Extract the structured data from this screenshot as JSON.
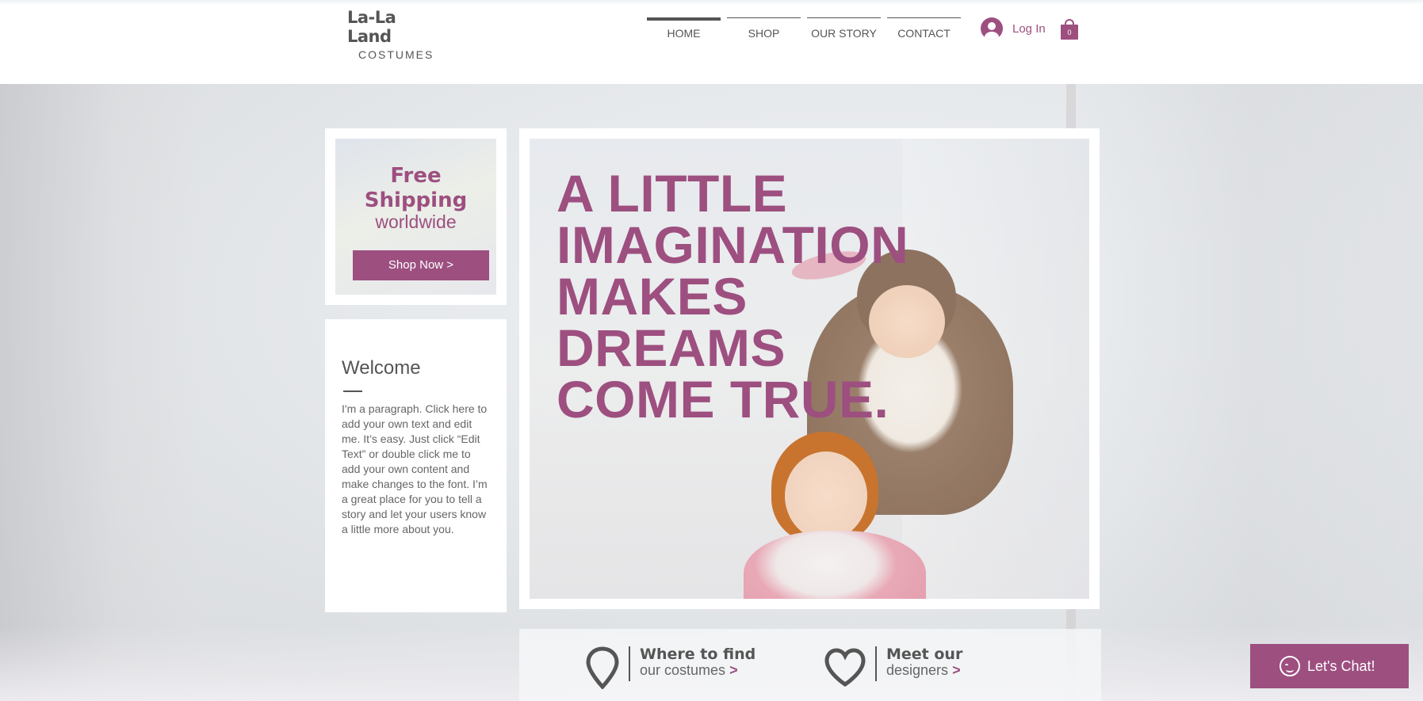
{
  "brand": {
    "name": "La-La Land",
    "tagline": "COSTUMES"
  },
  "nav": {
    "items": [
      {
        "label": "HOME",
        "active": true
      },
      {
        "label": "SHOP",
        "active": false
      },
      {
        "label": "OUR STORY",
        "active": false
      },
      {
        "label": "CONTACT",
        "active": false
      }
    ]
  },
  "account": {
    "login_label": "Log In",
    "cart_count": "0"
  },
  "promo": {
    "title_line1": "Free",
    "title_line2": "Shipping",
    "subtitle": "worldwide",
    "button_label": "Shop Now >"
  },
  "welcome": {
    "title": "Welcome",
    "paragraph": "I'm a paragraph. Click here to add your own text and edit me. It’s easy. Just click “Edit Text” or double click me to add your own content and make changes to the font. I’m a great place for you to tell a story and let your users know a little more about you."
  },
  "hero": {
    "lines": [
      "A LITTLE",
      "IMAGINATION",
      "MAKES",
      "DREAMS",
      "COME TRUE."
    ]
  },
  "info": {
    "find": {
      "line1": "Where to find",
      "line2": "our costumes",
      "arrow": ">",
      "icon": "map-pin-icon"
    },
    "designers": {
      "line1": "Meet our",
      "line2": "designers",
      "arrow": ">",
      "icon": "heart-icon"
    }
  },
  "chat": {
    "label": "Let's Chat!"
  },
  "colors": {
    "accent": "#9d4f80",
    "text": "#555555",
    "white": "#ffffff"
  }
}
